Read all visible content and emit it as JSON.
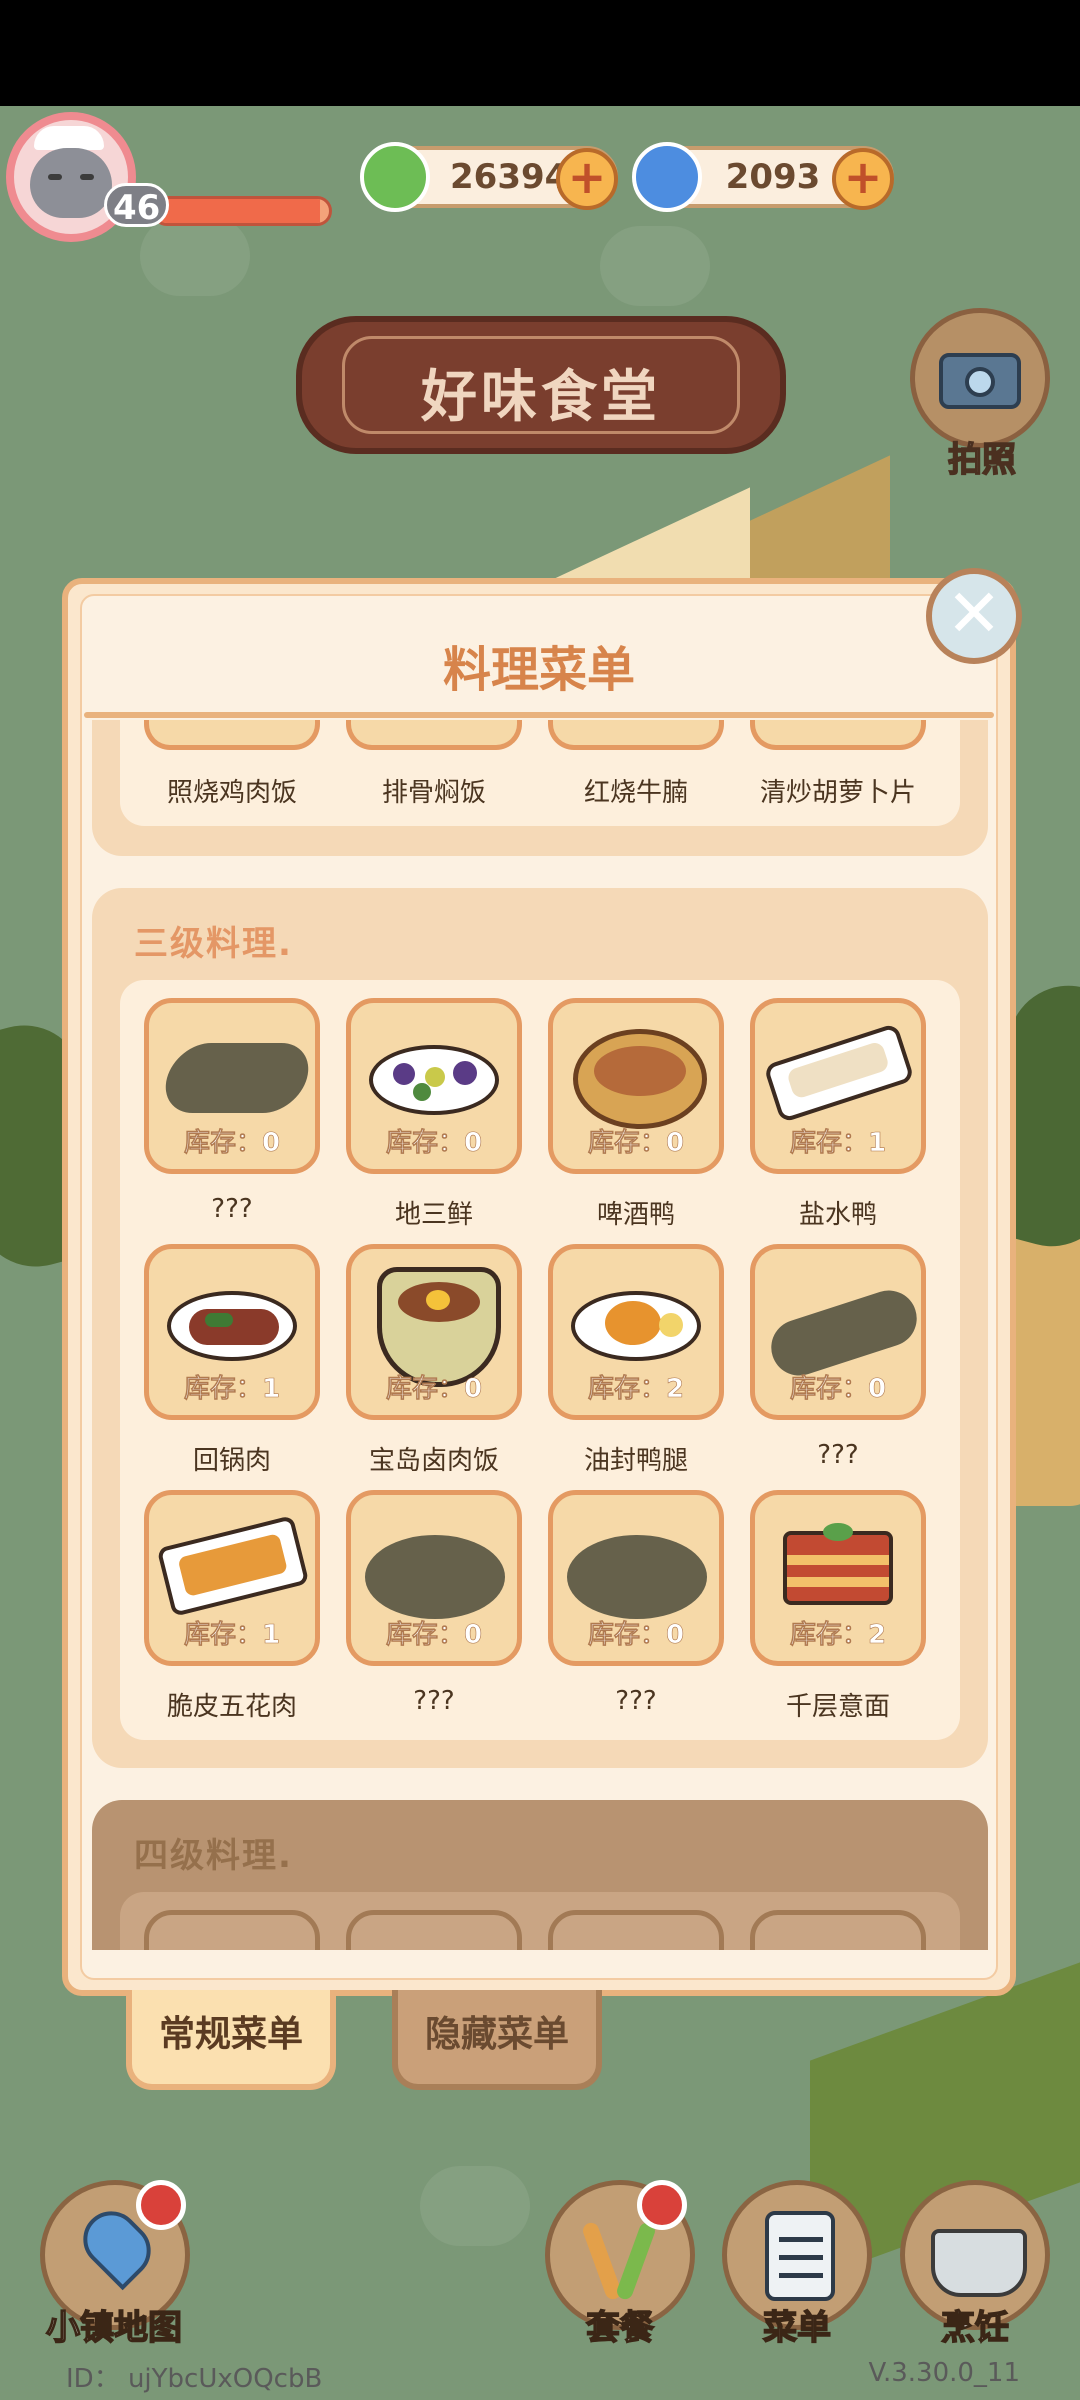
{
  "player": {
    "level": "46",
    "xp_fraction": 0.95
  },
  "currencies": [
    {
      "name": "leaf-coin",
      "value": "26394",
      "icon": "clover-coin-icon",
      "color": "#6dbd55"
    },
    {
      "name": "blue-gem",
      "value": "2093",
      "icon": "swirl-gem-icon",
      "color": "#4d8de0"
    }
  ],
  "sign": {
    "title": "好味食堂"
  },
  "camera": {
    "label": "拍照"
  },
  "panel": {
    "title": "料理菜单",
    "close_symbol": "✕",
    "partial_row": [
      "照烧鸡肉饭",
      "排骨焖饭",
      "红烧牛腩",
      "清炒胡萝卜片"
    ],
    "sections": [
      {
        "title": "三级料理.",
        "dishes": [
          {
            "name": "???",
            "stock": "库存：0",
            "locked": true
          },
          {
            "name": "地三鲜",
            "stock": "库存：0",
            "locked": false
          },
          {
            "name": "啤酒鸭",
            "stock": "库存：0",
            "locked": false
          },
          {
            "name": "盐水鸭",
            "stock": "库存：1",
            "locked": false
          },
          {
            "name": "回锅肉",
            "stock": "库存：1",
            "locked": false
          },
          {
            "name": "宝岛卤肉饭",
            "stock": "库存：0",
            "locked": false
          },
          {
            "name": "油封鸭腿",
            "stock": "库存：2",
            "locked": false
          },
          {
            "name": "???",
            "stock": "库存：0",
            "locked": true
          },
          {
            "name": "脆皮五花肉",
            "stock": "库存：1",
            "locked": false
          },
          {
            "name": "???",
            "stock": "库存：0",
            "locked": true
          },
          {
            "name": "???",
            "stock": "库存：0",
            "locked": true
          },
          {
            "name": "千层意面",
            "stock": "库存：2",
            "locked": false
          }
        ]
      },
      {
        "title": "四级料理."
      }
    ]
  },
  "tabs": [
    {
      "label": "常规菜单",
      "active": true
    },
    {
      "label": "隐藏菜单",
      "active": false
    }
  ],
  "bottom_nav": [
    {
      "label": "小镇地图",
      "icon": "map-pin-icon",
      "badge": true
    },
    {
      "label": "套餐",
      "icon": "skewer-icon",
      "badge": true
    },
    {
      "label": "菜单",
      "icon": "clipboard-icon",
      "badge": false
    },
    {
      "label": "烹饪",
      "icon": "pot-icon",
      "badge": false
    }
  ],
  "footer": {
    "id": "ID： ujYbcUxOQcbB",
    "version": "V.3.30.0_11"
  }
}
